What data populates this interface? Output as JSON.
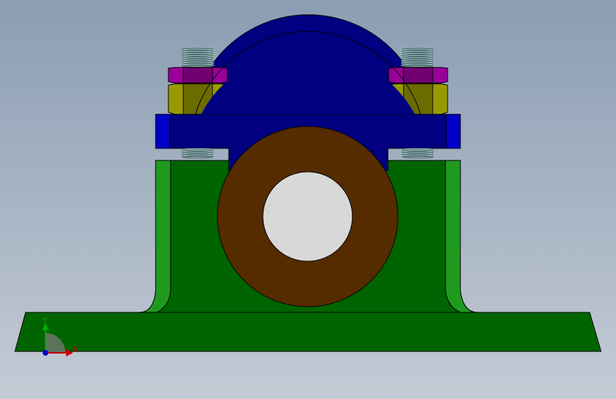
{
  "viewport": {
    "background_top": "#8b9db3",
    "background_bottom": "#c4cbd5"
  },
  "model": {
    "base_color": "#006400",
    "base_dark": "#004d00",
    "base_light": "#1f9a1f",
    "cap_color": "#000080",
    "cap_light": "#0000c8",
    "bushing_color": "#552b00",
    "bore_color": "#d8d8d8",
    "nut_top_color": "#990099",
    "nut_top_dark": "#700070",
    "nut_bottom_color": "#9a9a00",
    "nut_bottom_dark": "#6b6b00",
    "thread_color": "#8fb0b0",
    "edge_color": "#000000"
  },
  "triad": {
    "x_label": "X",
    "y_label": "Y",
    "x_color": "#cc0000",
    "y_color": "#00aa00",
    "z_color": "#0000cc",
    "arc_color": "#7a7a7a"
  }
}
